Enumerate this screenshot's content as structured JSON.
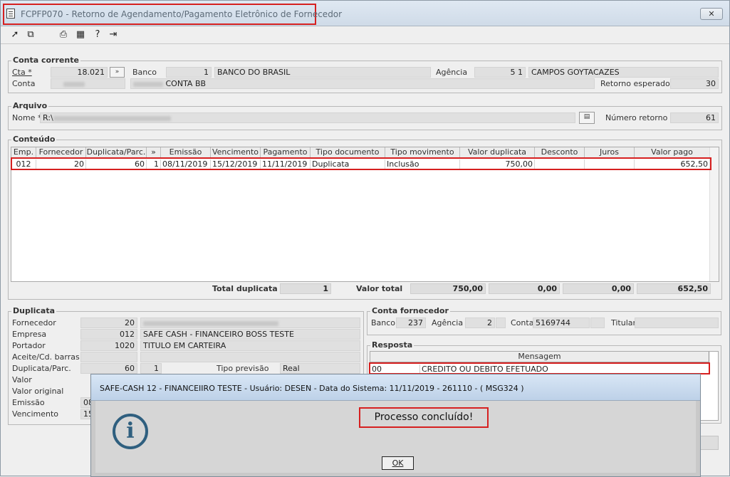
{
  "window": {
    "title": "FCPFP070 - Retorno de Agendamento/Pagamento Eletrônico de Fornecedor",
    "close_label": "✕"
  },
  "conta_corrente": {
    "legend": "Conta corrente",
    "cta_label": "Cta *",
    "cta_value": "18.021",
    "banco_label": "Banco",
    "banco_code": "1",
    "banco_name": "BANCO DO BRASIL",
    "agencia_label": "Agência",
    "agencia_code": "5 1",
    "agencia_name": "CAMPOS GOYTACAZES",
    "conta_label": "Conta",
    "conta_desc": "CONTA BB",
    "retorno_esperado_label": "Retorno esperado",
    "retorno_esperado_value": "30"
  },
  "arquivo": {
    "legend": "Arquivo",
    "nome_label": "Nome *",
    "nome_value": "R:\\",
    "numero_retorno_label": "Número retorno",
    "numero_retorno_value": "61"
  },
  "conteudo": {
    "legend": "Conteúdo",
    "columns": [
      "Emp.",
      "Fornecedor",
      "Duplicata/Parc.",
      "",
      "Emissão",
      "Vencimento",
      "Pagamento",
      "Tipo documento",
      "Tipo movimento",
      "Valor duplicata",
      "Desconto",
      "Juros",
      "Valor pago"
    ],
    "row": [
      "012",
      "20",
      "60",
      "1",
      "08/11/2019",
      "15/12/2019",
      "11/11/2019",
      "Duplicata",
      "Inclusão",
      "750,00",
      "",
      "",
      "652,50"
    ],
    "total_duplicata_label": "Total duplicata",
    "total_duplicata_value": "1",
    "valor_total_label": "Valor total",
    "valor_total_dup": "750,00",
    "valor_total_desc": "0,00",
    "valor_total_juros": "0,00",
    "valor_total_pago": "652,50"
  },
  "duplicata": {
    "legend": "Duplicata",
    "fornecedor_label": "Fornecedor",
    "fornecedor_value": "20",
    "empresa_label": "Empresa",
    "empresa_value": "012",
    "empresa_name": "SAFE CASH - FINANCEIRO BOSS TESTE",
    "portador_label": "Portador",
    "portador_value": "1020",
    "portador_name": "TITULO EM CARTEIRA",
    "aceite_label": "Aceite/Cd. barras",
    "dup_parc_label": "Duplicata/Parc.",
    "dup_value": "60",
    "parc_value": "1",
    "tipo_previsao_label": "Tipo previsão",
    "tipo_previsao_value": "Real",
    "valor_label": "Valor",
    "valor_original_label": "Valor original",
    "emissao_label": "Emissão",
    "emissao_partial": "08",
    "vencimento_label": "Vencimento",
    "vencimento_partial": "15"
  },
  "conta_fornecedor": {
    "legend": "Conta fornecedor",
    "banco_label": "Banco",
    "banco_value": "237",
    "agencia_label": "Agência",
    "agencia_value": "2",
    "conta_label": "Conta",
    "conta_value": "5169744",
    "titular_label": "Titular"
  },
  "resposta": {
    "legend": "Resposta",
    "col_mensagem": "Mensagem",
    "code": "00",
    "message": "CREDITO OU DEBITO EFETUADO"
  },
  "dialog": {
    "title": "SAFE-CASH 12 - FINANCEIIRO TESTE - Usuário: DESEN - Data do Sistema: 11/11/2019 - 261110 - ( MSG324 )",
    "message": "Processo concluído!",
    "ok_label": "OK"
  },
  "colors": {
    "highlight": "#d62020",
    "info_icon": "#2f5f7f"
  }
}
